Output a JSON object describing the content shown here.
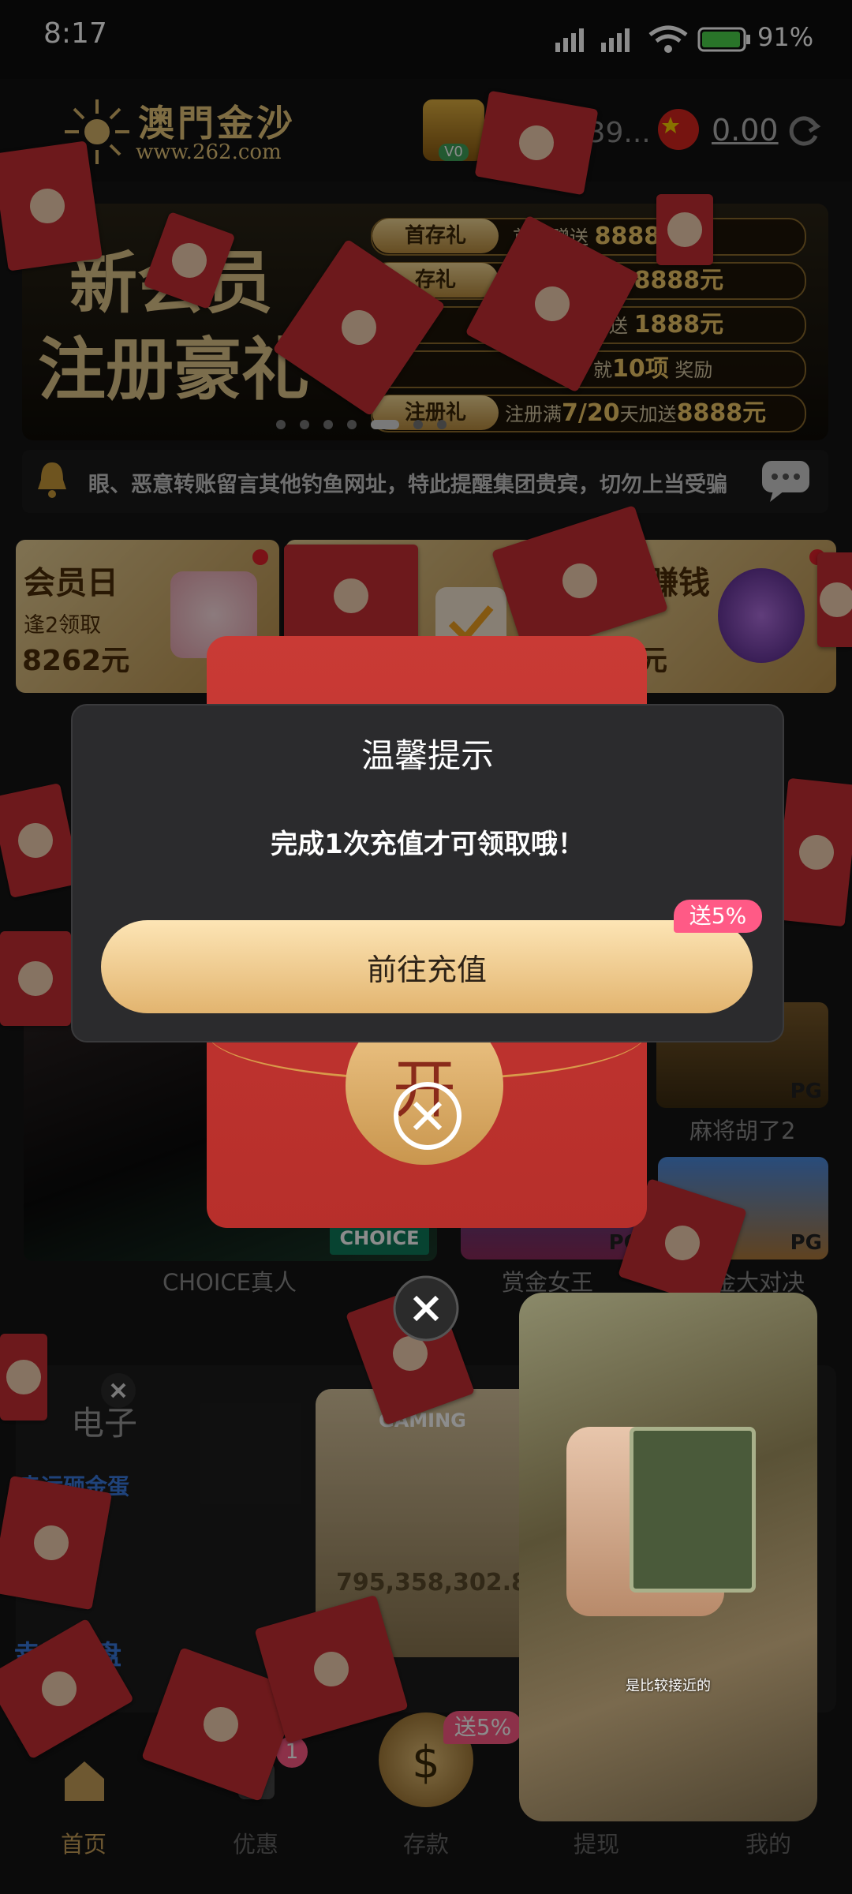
{
  "status_bar": {
    "time": "8:17",
    "battery": "91%"
  },
  "header": {
    "logo_cn": "澳門金沙",
    "logo_url": "www.262.com",
    "vip_level": "V0",
    "username": "qgiz39...",
    "balance": "0.00"
  },
  "banner": {
    "headline_1": "新会员",
    "headline_2": "注册豪礼",
    "rows": [
      {
        "label": "首存礼",
        "text": "首存赠送",
        "highlight": "8888"
      },
      {
        "label": "存礼",
        "text": "送",
        "highlight": "8888元"
      },
      {
        "label": "",
        "text": "送",
        "highlight": "1888元"
      },
      {
        "label": "",
        "text": "就",
        "highlight": "10项",
        "suffix": "奖励"
      },
      {
        "label": "注册礼",
        "text": "注册满",
        "highlight": "7/20",
        "suffix": "天加送",
        "highlight2": "8888元"
      }
    ]
  },
  "marquee": {
    "text": "眼、恶意转账留言其他钓鱼网址，特此提醒集团贵宾，切勿上当受骗"
  },
  "cards": [
    {
      "title": "会员日",
      "sub": "逢2领取",
      "amount": "8262元"
    },
    {
      "title": "",
      "sub": "",
      "amount": ""
    },
    {
      "title": "赚钱",
      "sub": "",
      "amount": "元"
    }
  ],
  "games": {
    "choice_label": "CHOICE真人",
    "choice_logo": "CHOICE",
    "pg_badge": "PG",
    "tiles": [
      {
        "caption": "麻将胡了2"
      },
      {
        "caption": "赏金女王"
      },
      {
        "caption": "金大对决"
      }
    ]
  },
  "section": {
    "title": "电子",
    "gaming_label": "GAMING",
    "slot_number": "795,358,302.84",
    "promo1": "幸运砸金蛋",
    "promo2": "幸运转盘"
  },
  "dialog": {
    "title": "温馨提示",
    "message": "完成1次充值才可领取哦！",
    "button": "前往充值",
    "badge": "送5%"
  },
  "envelope": {
    "open_label": "开"
  },
  "bottom_nav": {
    "items": [
      {
        "label": "首页"
      },
      {
        "label": "优惠",
        "badge": "1"
      },
      {
        "label": "存款",
        "badge": "送5%"
      },
      {
        "label": "提现"
      },
      {
        "label": "我的"
      }
    ]
  },
  "video": {
    "caption": "是比较接近的"
  },
  "colors": {
    "accent_gold": "#e2b46f",
    "envelope_red": "#c72f33",
    "badge_pink": "#ff5a86"
  }
}
